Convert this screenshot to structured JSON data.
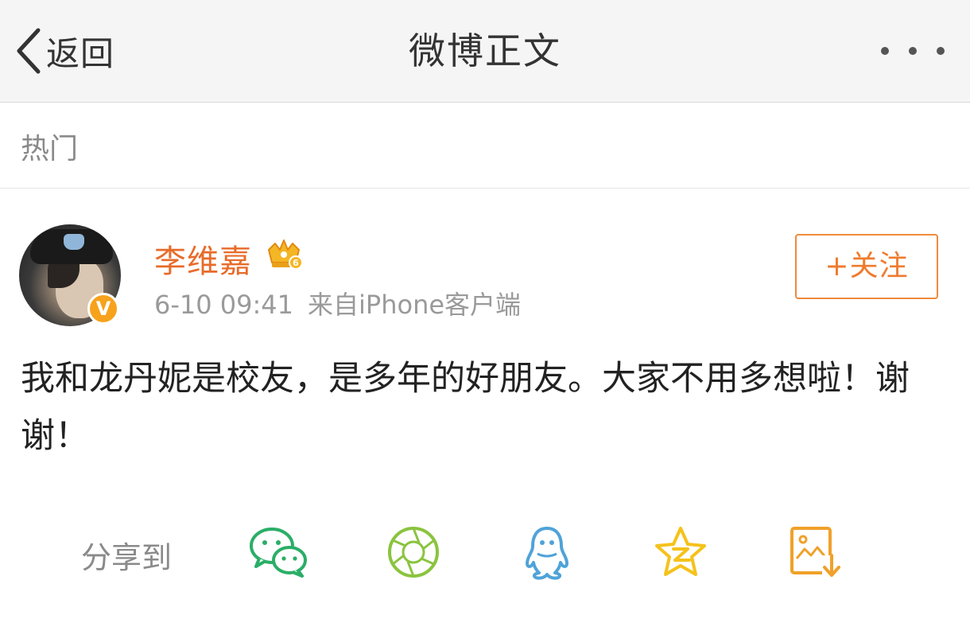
{
  "navbar": {
    "back_label": "返回",
    "title": "微博正文"
  },
  "section": {
    "label": "热门"
  },
  "post": {
    "author": "李维嘉",
    "verified_mark": "V",
    "crown_level": "6",
    "date": "6-10 09:41",
    "source": "来自iPhone客户端",
    "follow_label": "+关注",
    "content": "我和龙丹妮是校友，是多年的好朋友。大家不用多想啦！谢谢！"
  },
  "share": {
    "label": "分享到",
    "targets": [
      "wechat-icon",
      "moments-icon",
      "qq-icon",
      "qzone-icon",
      "save-image-icon"
    ]
  },
  "colors": {
    "accent_orange": "#e86b2a",
    "wechat_green": "#2aae67",
    "moments_green": "#8ac43f",
    "qq_blue": "#4fa3d8",
    "qzone_yellow": "#f5c21b",
    "save_orange": "#f0a12a"
  }
}
